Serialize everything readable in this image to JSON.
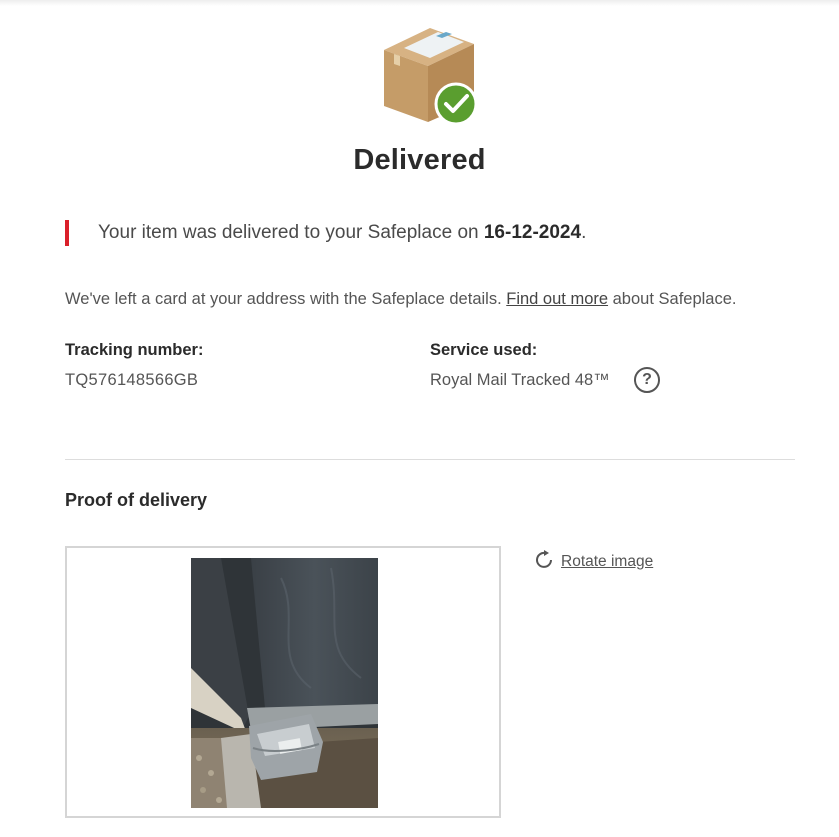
{
  "status": {
    "title": "Delivered",
    "icon": "parcel-delivered-icon"
  },
  "notice": {
    "prefix": "Your item was delivered to your Safeplace on ",
    "date": "16-12-2024",
    "suffix": ".",
    "accent_color": "#da202a"
  },
  "card_message": {
    "before": "We've left a card at your address with the Safeplace details. ",
    "link": "Find out more",
    "after": " about Safeplace."
  },
  "tracking": {
    "label": "Tracking number:",
    "value": "TQ576148566GB"
  },
  "service": {
    "label": "Service used:",
    "value": "Royal Mail Tracked 48™",
    "help_icon": "question-icon",
    "help_glyph": "?"
  },
  "proof": {
    "title": "Proof of delivery",
    "rotate_label": "Rotate image",
    "rotate_icon": "rotate-icon",
    "photo_icon": "delivery-photo"
  },
  "colors": {
    "check_green": "#5a9e2f",
    "box_brown": "#c9a36f"
  }
}
